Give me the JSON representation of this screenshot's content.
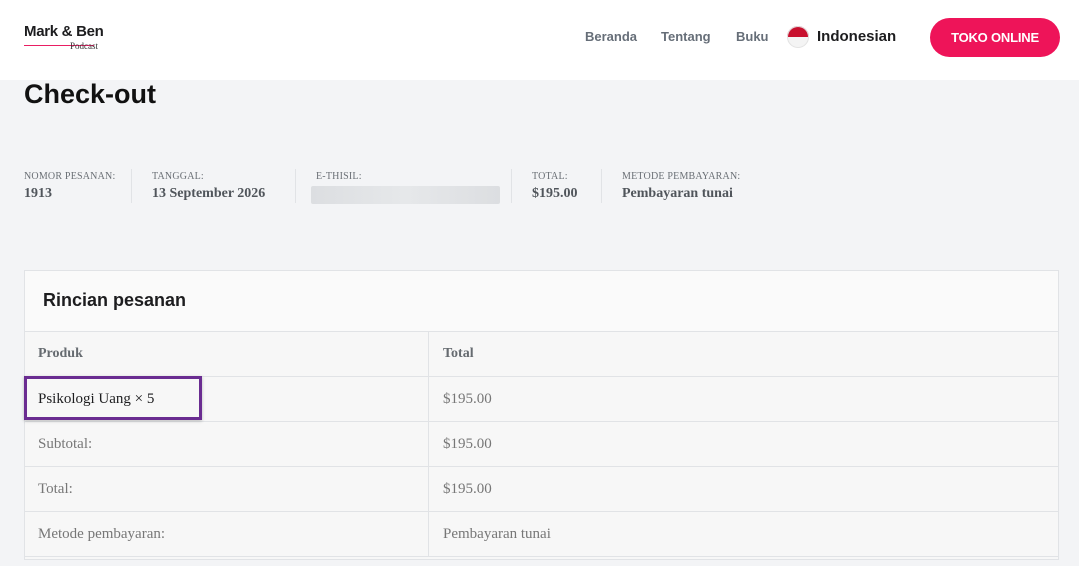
{
  "header": {
    "logo": {
      "main": "Mark & Ben",
      "sub": "Podcast"
    },
    "nav": [
      "Beranda",
      "Tentang",
      "Buku"
    ],
    "language": "Indonesian",
    "shop_button": "TOKO ONLINE"
  },
  "page_title": "Check-out",
  "overview": [
    {
      "label": "NOMOR PESANAN:",
      "value": "1913"
    },
    {
      "label": "TANGGAL:",
      "value": "13 September 2026"
    },
    {
      "label": "E-THISIL:",
      "value": ""
    },
    {
      "label": "TOTAL:",
      "value": "$195.00"
    },
    {
      "label": "METODE PEMBAYARAN:",
      "value": "Pembayaran tunai"
    }
  ],
  "order_details": {
    "title": "Rincian pesanan",
    "columns": [
      "Produk",
      "Total"
    ],
    "rows": [
      {
        "label": "Psikologi Uang × 5",
        "value": "$195.00"
      },
      {
        "label": "Subtotal:",
        "value": "$195.00"
      },
      {
        "label": "Total:",
        "value": "$195.00"
      },
      {
        "label": "Metode pembayaran:",
        "value": "Pembayaran tunai"
      }
    ]
  },
  "colors": {
    "accent": "#ee1459",
    "highlight": "#6a2c91"
  }
}
